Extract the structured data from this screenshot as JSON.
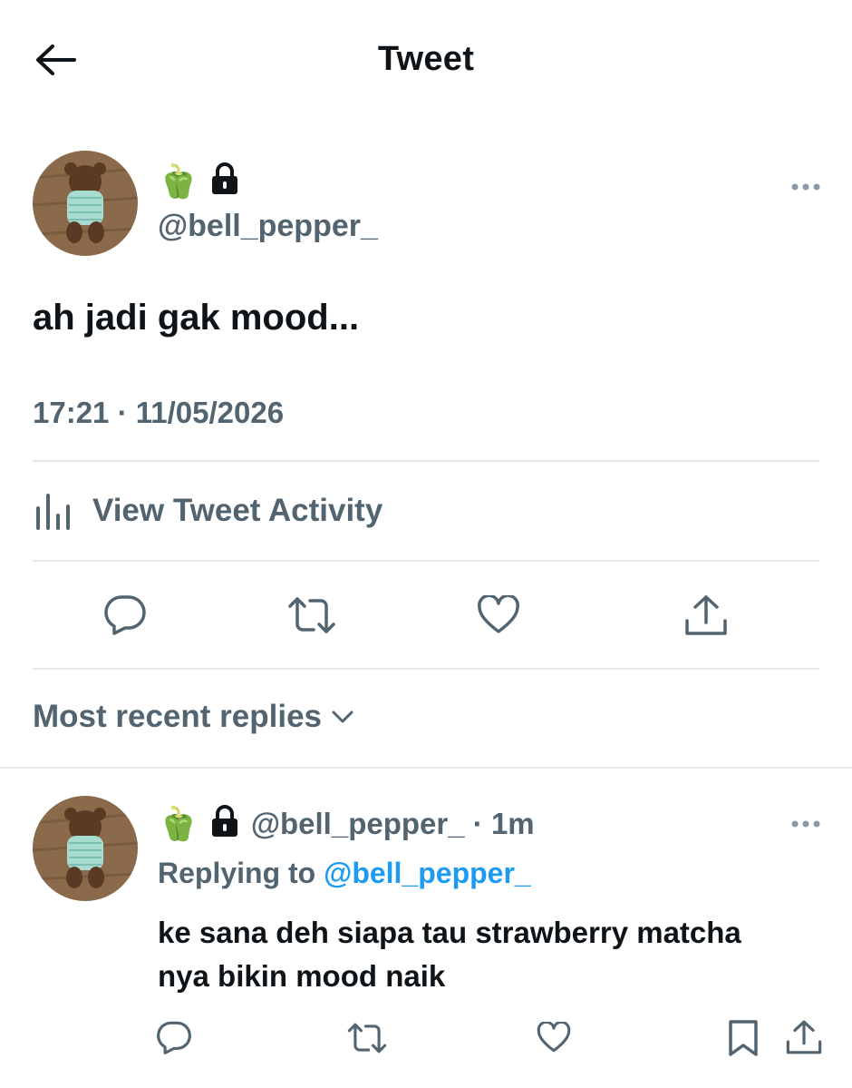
{
  "header": {
    "title": "Tweet"
  },
  "tweet": {
    "display_name_emoji": "🫑",
    "handle": "@bell_pepper_",
    "text": "ah jadi gak mood...",
    "time": "17:21",
    "date": "11/05/2026",
    "separator": "·",
    "activity_label": "View Tweet Activity"
  },
  "replies_sort": {
    "label": "Most recent replies"
  },
  "reply": {
    "display_name_emoji": "🫑",
    "handle": "@bell_pepper_",
    "age": "1m",
    "separator": "·",
    "replying_prefix": "Replying to",
    "replying_handle": "@bell_pepper_",
    "text": "ke sana deh siapa tau strawberry matcha nya bikin mood naik"
  },
  "colors": {
    "accent": "#1d9bf0",
    "muted": "#536471",
    "divider": "#e4e9ed"
  },
  "icons": [
    "back-arrow-icon",
    "lock-icon",
    "more-icon",
    "activity-chart-icon",
    "reply-icon",
    "retweet-icon",
    "like-icon",
    "share-icon",
    "bookmark-icon",
    "chevron-down-icon"
  ]
}
